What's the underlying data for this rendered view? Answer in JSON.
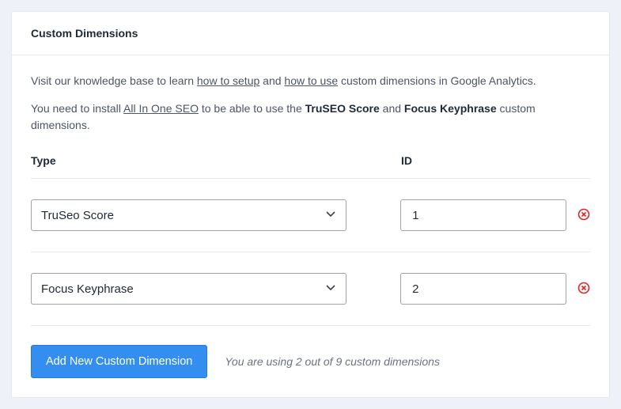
{
  "header": {
    "title": "Custom Dimensions"
  },
  "intro": {
    "part1": "Visit our knowledge base to learn ",
    "link1": "how to setup",
    "part2": " and ",
    "link2": "how to use",
    "part3": " custom dimensions in Google Analytics.",
    "part4a": "You need to install ",
    "link3": "All In One SEO",
    "part4b": " to be able to use the ",
    "strong1": "TruSEO Score",
    "part4c": " and ",
    "strong2": "Focus Keyphrase",
    "part4d": " custom dimensions."
  },
  "columns": {
    "type": "Type",
    "id": "ID"
  },
  "rows": [
    {
      "type": "TruSeo Score",
      "id": "1"
    },
    {
      "type": "Focus Keyphrase",
      "id": "2"
    }
  ],
  "buttons": {
    "add": "Add New Custom Dimension"
  },
  "usage": "You are using 2 out of 9 custom dimensions"
}
